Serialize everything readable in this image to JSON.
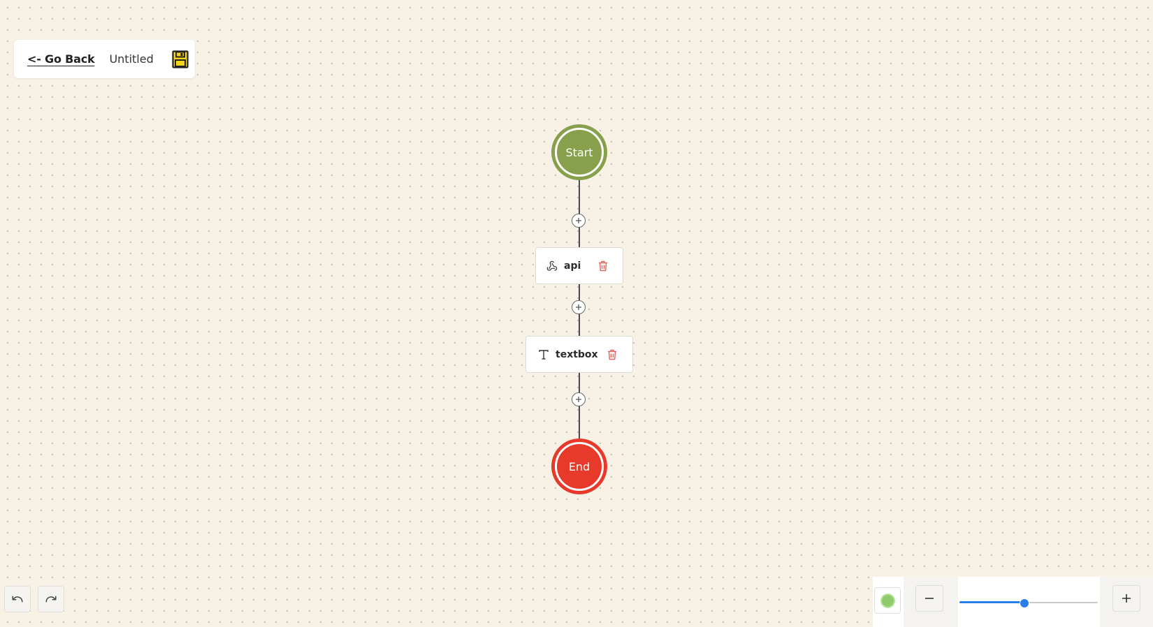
{
  "toolbar": {
    "go_back_label": "<- Go Back",
    "title": "Untitled",
    "save_icon": "floppy-disk-icon",
    "save_icon_color": "#f5d515"
  },
  "flow": {
    "start_label": "Start",
    "end_label": "End",
    "start_color": "#88a04c",
    "end_color": "#e83a2b",
    "nodes": [
      {
        "label": "api",
        "icon": "webhook-icon"
      },
      {
        "label": "textbox",
        "icon": "text-type-icon"
      }
    ],
    "add_icon": "plus-icon",
    "delete_icon": "trash-icon",
    "delete_icon_color": "#e0645a"
  },
  "history": {
    "undo_icon": "undo-icon",
    "redo_icon": "redo-icon"
  },
  "zoom": {
    "status_color": "#8fcb6a",
    "level_fraction": 0.47,
    "accent_color": "#2a7ee8"
  }
}
